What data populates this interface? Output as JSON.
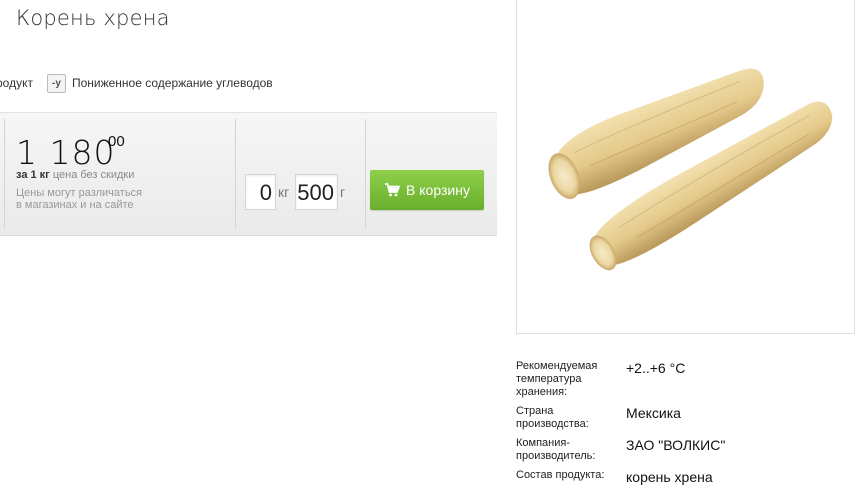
{
  "product": {
    "title": "Корень хрена"
  },
  "tags": {
    "partial_text": "родукт",
    "badge_text": "-у",
    "low_carb": "Пониженное содержание углеводов"
  },
  "price": {
    "main": "1 180",
    "kopecks": "00",
    "per": "за 1 кг",
    "per_note": "цена без скидки",
    "note_line1": "Цены могут различаться",
    "note_line2": "в магазинах и на сайте"
  },
  "quantity": {
    "kg_value": "0",
    "kg_unit": "кг",
    "g_value": "500",
    "g_unit": "г"
  },
  "cart_button": {
    "label": "В корзину"
  },
  "properties": [
    {
      "label": "Рекомендуемая температура хранения:",
      "value": "+2..+6 °С"
    },
    {
      "label": "Страна производства:",
      "value": "Мексика"
    },
    {
      "label": "Компания-производитель:",
      "value": "ЗАО \"ВОЛКИС\""
    },
    {
      "label": "Состав продукта:",
      "value": "корень хрена"
    }
  ],
  "colors": {
    "accent_green": "#7bbf3a",
    "panel_bg": "#efefef"
  }
}
